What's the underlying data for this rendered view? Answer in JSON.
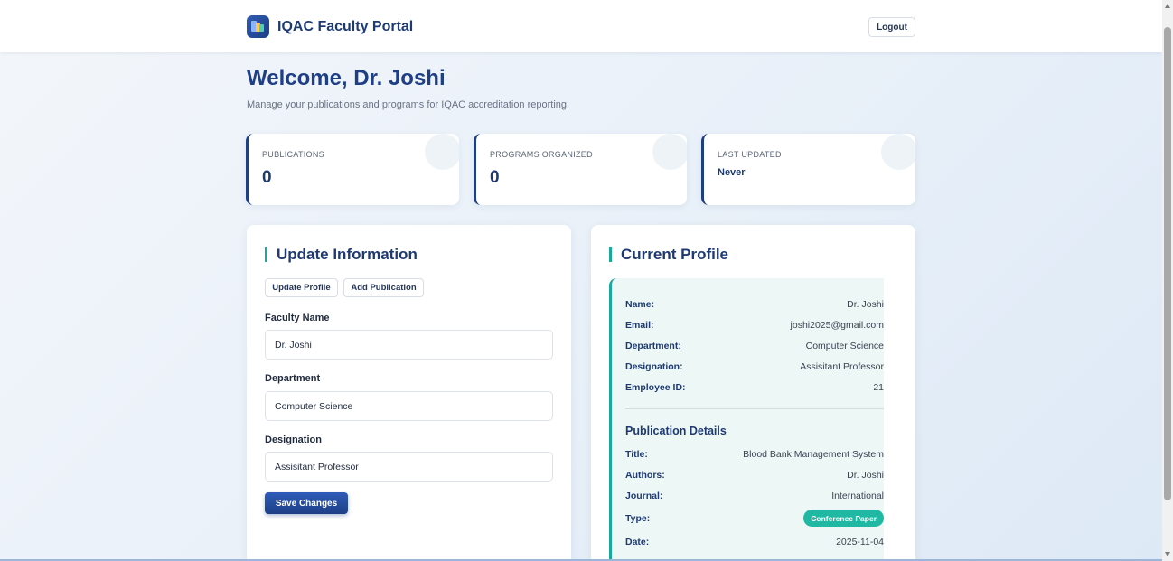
{
  "header": {
    "brand": "IQAC Faculty Portal",
    "logout_label": "Logout"
  },
  "welcome": {
    "title": "Welcome, Dr. Joshi",
    "subtitle": "Manage your publications and programs for IQAC accreditation reporting"
  },
  "stats": [
    {
      "label": "PUBLICATIONS",
      "value": "0"
    },
    {
      "label": "PROGRAMS ORGANIZED",
      "value": "0"
    },
    {
      "label": "LAST UPDATED",
      "value": "Never"
    }
  ],
  "update_card": {
    "title": "Update Information",
    "tabs": [
      "Update Profile",
      "Add Publication"
    ],
    "fields": [
      {
        "label": "Faculty Name",
        "value": "Dr. Joshi"
      },
      {
        "label": "Department",
        "value": "Computer Science"
      },
      {
        "label": "Designation",
        "value": "Assisitant Professor"
      }
    ],
    "save_label": "Save Changes"
  },
  "profile_card": {
    "title": "Current Profile",
    "rows": [
      {
        "key": "Name:",
        "value": "Dr. Joshi"
      },
      {
        "key": "Email:",
        "value": "joshi2025@gmail.com"
      },
      {
        "key": "Department:",
        "value": "Computer Science"
      },
      {
        "key": "Designation:",
        "value": "Assisitant Professor"
      },
      {
        "key": "Employee ID:",
        "value": "21"
      }
    ],
    "publication_heading": "Publication Details",
    "publication_rows": [
      {
        "key": "Title:",
        "value": "Blood Bank Management System"
      },
      {
        "key": "Authors:",
        "value": "Dr. Joshi"
      },
      {
        "key": "Journal:",
        "value": "International"
      },
      {
        "key": "Type:",
        "value": "Conference Paper"
      },
      {
        "key": "Date:",
        "value": "2025-11-04"
      }
    ]
  },
  "colors": {
    "primary": "#1e3f86",
    "accent": "#1aa89a",
    "badge": "#1fb9a3"
  },
  "icons": {
    "logo": "portal-logo-icon"
  }
}
